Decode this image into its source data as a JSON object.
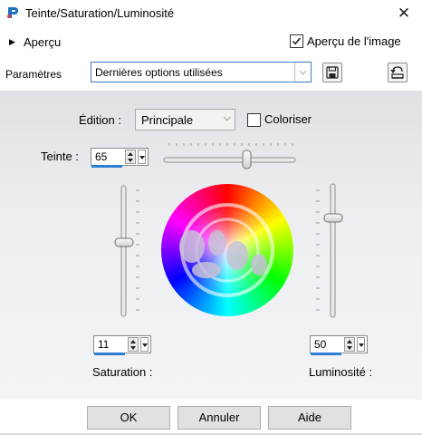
{
  "window": {
    "title": "Teinte/Saturation/Luminosité",
    "close_glyph": "✕"
  },
  "preview": {
    "label": "Aperçu",
    "image_preview_label": "Aperçu de l'image",
    "image_preview_checked": true
  },
  "params": {
    "label": "Paramètres",
    "preset_value": "Dernières options utilisées"
  },
  "edit": {
    "label": "Édition :",
    "value": "Principale",
    "colorize_label": "Coloriser",
    "colorize_checked": false
  },
  "hue": {
    "label": "Teinte :",
    "value": "65"
  },
  "saturation": {
    "label": "Saturation :",
    "value": "11"
  },
  "lightness": {
    "label": "Luminosité :",
    "value": "50"
  },
  "buttons": {
    "ok": "OK",
    "cancel": "Annuler",
    "help": "Aide"
  },
  "icons": {
    "app": "paint-app-icon",
    "save": "floppy-disk-icon",
    "reset": "reset-defaults-icon"
  }
}
